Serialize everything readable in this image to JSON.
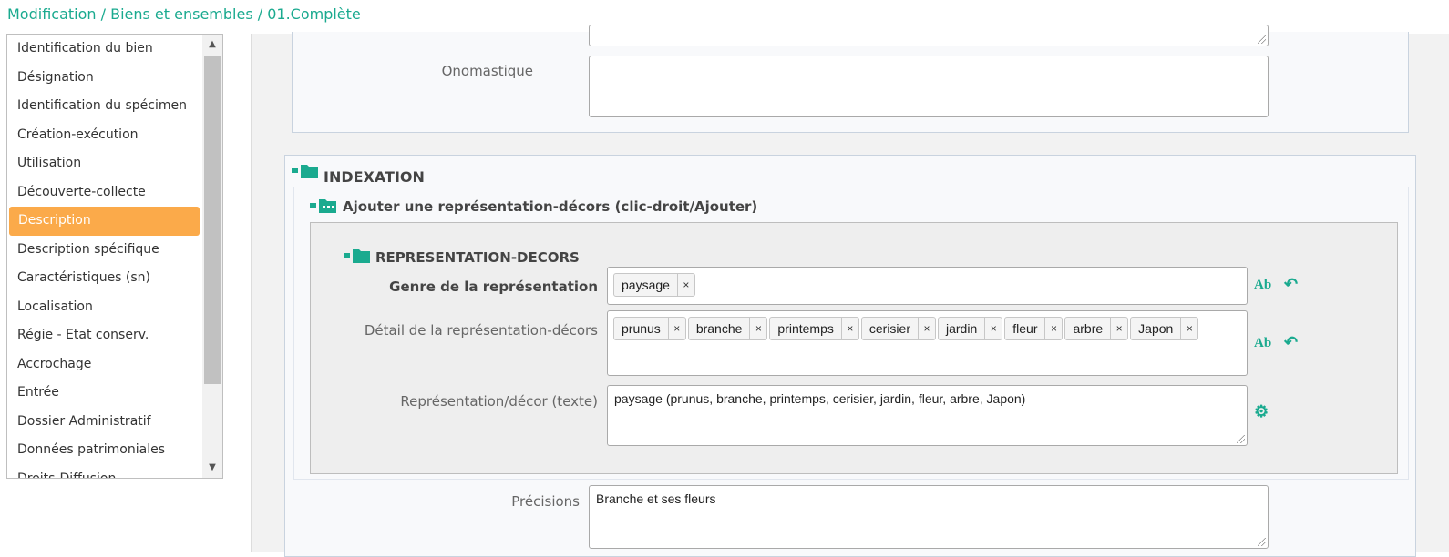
{
  "breadcrumb": "Modification / Biens et ensembles / 01.Complète",
  "sidebar": {
    "items": [
      {
        "label": "Identification du bien"
      },
      {
        "label": "Désignation"
      },
      {
        "label": "Identification du spécimen"
      },
      {
        "label": "Création-exécution"
      },
      {
        "label": "Utilisation"
      },
      {
        "label": "Découverte-collecte"
      },
      {
        "label": "Description",
        "active": true
      },
      {
        "label": "Description spécifique"
      },
      {
        "label": "Caractéristiques (sn)"
      },
      {
        "label": "Localisation"
      },
      {
        "label": "Régie - Etat conserv."
      },
      {
        "label": "Accrochage"
      },
      {
        "label": "Entrée"
      },
      {
        "label": "Dossier Administratif"
      },
      {
        "label": "Données patrimoniales"
      },
      {
        "label": "Droits-Diffusion"
      }
    ]
  },
  "form": {
    "onomastique_label": "Onomastique",
    "onomastique_value": "",
    "indexation_title": "INDEXATION",
    "add_title": "Ajouter une représentation-décors (clic-droit/Ajouter)",
    "repr_title": "REPRESENTATION-DECORS",
    "genre_label": "Genre de la représentation",
    "genre_tags": [
      "paysage"
    ],
    "detail_label": "Détail de la représentation-décors",
    "detail_tags": [
      "prunus",
      "branche",
      "printemps",
      "cerisier",
      "jardin",
      "fleur",
      "arbre",
      "Japon"
    ],
    "texte_label": "Représentation/décor (texte)",
    "texte_value": "paysage (prunus, branche, printemps, cerisier, jardin, fleur, arbre, Japon)",
    "precisions_label": "Précisions",
    "precisions_value": "Branche et ses fleurs",
    "tag_remove_glyph": "×",
    "format_icon_glyph": "Ab",
    "undo_icon_glyph": "↶",
    "gear_icon_glyph": "⚙"
  },
  "colors": {
    "accent": "#1aaa8f",
    "active_item": "#fbaa4a"
  }
}
